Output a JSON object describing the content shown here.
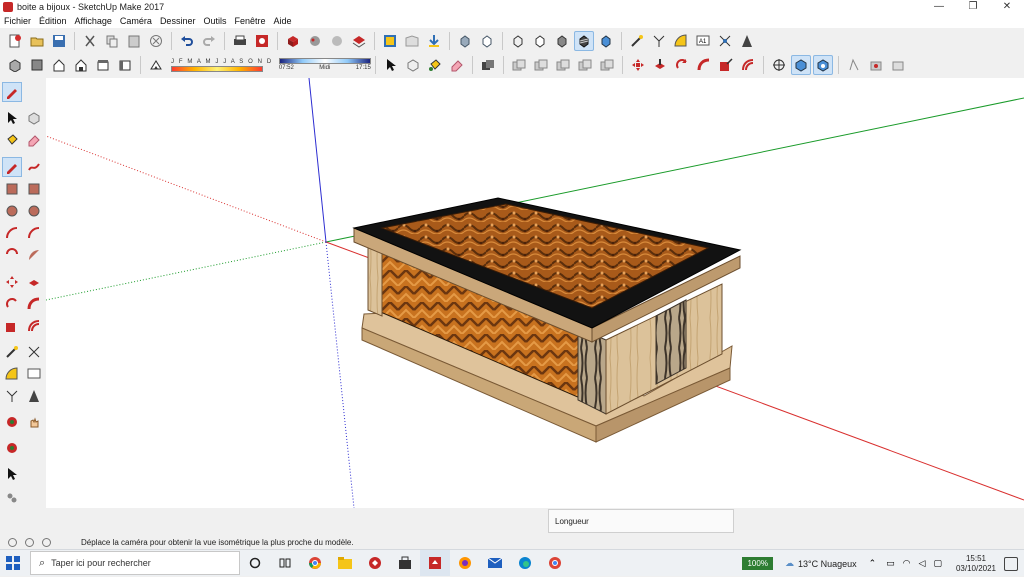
{
  "window": {
    "title": "boite a bijoux - SketchUp Make 2017",
    "controls": [
      "—",
      "❐",
      "✕"
    ]
  },
  "menu": [
    "Fichier",
    "Édition",
    "Affichage",
    "Caméra",
    "Dessiner",
    "Outils",
    "Fenêtre",
    "Aide"
  ],
  "toolbar1_icons": [
    "new-file",
    "open-file",
    "save-file",
    "cut",
    "copy",
    "paste",
    "erase",
    "undo",
    "redo",
    "print",
    "model-info",
    "components",
    "materials",
    "styles",
    "layers",
    "3d-warehouse",
    "extension-warehouse",
    "send-to-layout",
    "xray",
    "back-edges",
    "wireframe",
    "hidden-line",
    "shaded",
    "shaded-textures",
    "monochrome",
    "tape-measure",
    "axes",
    "protractor",
    "text",
    "dimension",
    "section-plane"
  ],
  "shadow": {
    "months": "J F M A M J J A S O N D",
    "time_start": "07:52",
    "time_mid": "Midi",
    "time_end": "17:15"
  },
  "toolbar2_icons": [
    "iso",
    "top",
    "front",
    "right",
    "back",
    "left"
  ],
  "status": {
    "measure_label": "Longueur",
    "message": "Déplace la caméra pour obtenir la vue isométrique la plus proche du modèle."
  },
  "taskbar": {
    "search_placeholder": "Taper ici pour rechercher",
    "battery": "100%",
    "weather": "13°C  Nuageux",
    "time": "15:51",
    "date": "03/10/2021"
  },
  "colors": {
    "axis_red": "#d9302f",
    "axis_green": "#1a9b2a",
    "axis_blue": "#2d2dd1",
    "wood_light": "#d9b98d",
    "wood_dark": "#8b5a2b",
    "burl": "#b8651c",
    "black_trim": "#121212"
  }
}
